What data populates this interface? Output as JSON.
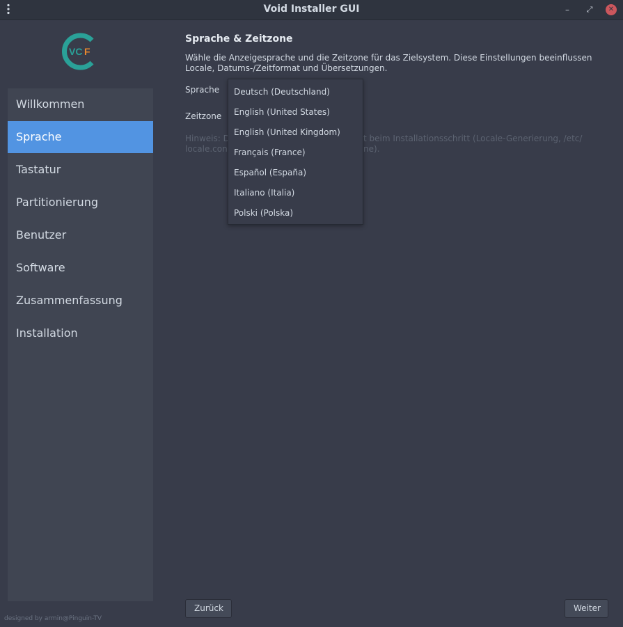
{
  "window": {
    "title": "Void Installer GUI",
    "menu_icon": "kebab-menu-icon",
    "minimize_glyph": "–",
    "maximize_glyph": "⤢",
    "close_glyph": "✕"
  },
  "logo": {
    "text": "VCF",
    "colors": {
      "ring": "#2aa198",
      "text_vc": "#2aa198",
      "text_f": "#e8882f"
    }
  },
  "sidebar": {
    "items": [
      {
        "label": "Willkommen",
        "active": false
      },
      {
        "label": "Sprache",
        "active": true
      },
      {
        "label": "Tastatur",
        "active": false
      },
      {
        "label": "Partitionierung",
        "active": false
      },
      {
        "label": "Benutzer",
        "active": false
      },
      {
        "label": "Software",
        "active": false
      },
      {
        "label": "Zusammenfassung",
        "active": false
      },
      {
        "label": "Installation",
        "active": false
      }
    ],
    "credits": "designed by armin@Pinguin-TV"
  },
  "main": {
    "heading": "Sprache & Zeitzone",
    "description": "Wähle die Anzeigesprache und die Zeitzone für das Zielsystem. Diese Einstellungen beeinflussen Locale, Datums-/Zeitformat und Übersetzungen.",
    "language_label": "Sprache",
    "timezone_label": "Zeitzone",
    "hint_left": "Hinweis: D",
    "hint_right": "t beim Installationsschritt (Locale-Generierung, /etc/",
    "hint_line2_left": "locale.con",
    "hint_line2_right": "ne)."
  },
  "language_dropdown": {
    "options": [
      "Deutsch (Deutschland)",
      "English (United States)",
      "English (United Kingdom)",
      "Français (France)",
      "Español (España)",
      "Italiano (Italia)",
      "Polski (Polska)"
    ]
  },
  "footer": {
    "back_label": "Zurück",
    "next_label": "Weiter"
  },
  "colors": {
    "accent": "#5294e2",
    "background": "#383c4a",
    "sidebar": "#404552",
    "titlebar": "#2f343f",
    "close": "#cc575d"
  }
}
